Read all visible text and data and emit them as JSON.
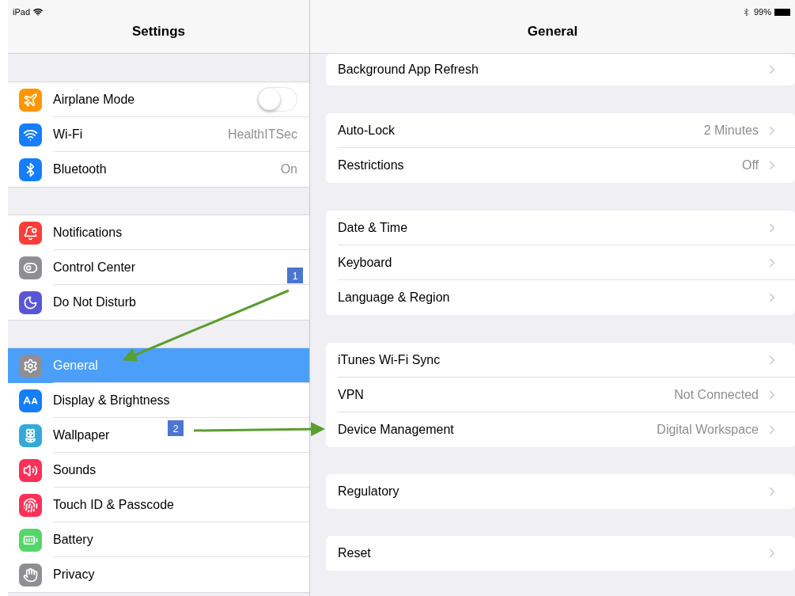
{
  "status_bar": {
    "device": "iPad",
    "battery": "99%"
  },
  "sidebar": {
    "title": "Settings",
    "groups": [
      {
        "items": [
          {
            "label": "Airplane Mode",
            "kind": "toggle",
            "on": false,
            "selected": false,
            "color": "#ff9500"
          },
          {
            "label": "Wi-Fi",
            "kind": "value",
            "value": "HealthITSec",
            "selected": false,
            "color": "#147efb"
          },
          {
            "label": "Bluetooth",
            "kind": "value",
            "value": "On",
            "selected": false,
            "color": "#147efb"
          }
        ]
      },
      {
        "items": [
          {
            "label": "Notifications",
            "kind": "plain",
            "selected": false,
            "color": "#fc3d39"
          },
          {
            "label": "Control Center",
            "kind": "plain",
            "selected": false,
            "color": "#8e8e93"
          },
          {
            "label": "Do Not Disturb",
            "kind": "plain",
            "selected": false,
            "color": "#5856d6"
          }
        ]
      },
      {
        "items": [
          {
            "label": "General",
            "kind": "plain",
            "selected": true,
            "color": "#8e8e93"
          },
          {
            "label": "Display & Brightness",
            "kind": "plain",
            "selected": false,
            "color": "#147efb"
          },
          {
            "label": "Wallpaper",
            "kind": "plain",
            "selected": false,
            "color": "#34aadc"
          },
          {
            "label": "Sounds",
            "kind": "plain",
            "selected": false,
            "color": "#fc3158"
          },
          {
            "label": "Touch ID & Passcode",
            "kind": "plain",
            "selected": false,
            "color": "#fc3158"
          },
          {
            "label": "Battery",
            "kind": "plain",
            "selected": false,
            "color": "#53d769"
          },
          {
            "label": "Privacy",
            "kind": "plain",
            "selected": false,
            "color": "#8e8e93"
          }
        ]
      }
    ]
  },
  "detail": {
    "title": "General",
    "groups": [
      {
        "rows": [
          {
            "label": "Background App Refresh"
          }
        ]
      },
      {
        "rows": [
          {
            "label": "Auto-Lock",
            "value": "2 Minutes"
          },
          {
            "label": "Restrictions",
            "value": "Off"
          }
        ]
      },
      {
        "rows": [
          {
            "label": "Date & Time"
          },
          {
            "label": "Keyboard"
          },
          {
            "label": "Language & Region"
          }
        ]
      },
      {
        "rows": [
          {
            "label": "iTunes Wi-Fi Sync"
          },
          {
            "label": "VPN",
            "value": "Not Connected"
          },
          {
            "label": "Device Management",
            "value": "Digital Workspace"
          }
        ]
      },
      {
        "rows": [
          {
            "label": "Regulatory"
          }
        ]
      },
      {
        "rows": [
          {
            "label": "Reset"
          }
        ]
      }
    ]
  },
  "annotations": [
    {
      "label": "1"
    },
    {
      "label": "2"
    }
  ]
}
